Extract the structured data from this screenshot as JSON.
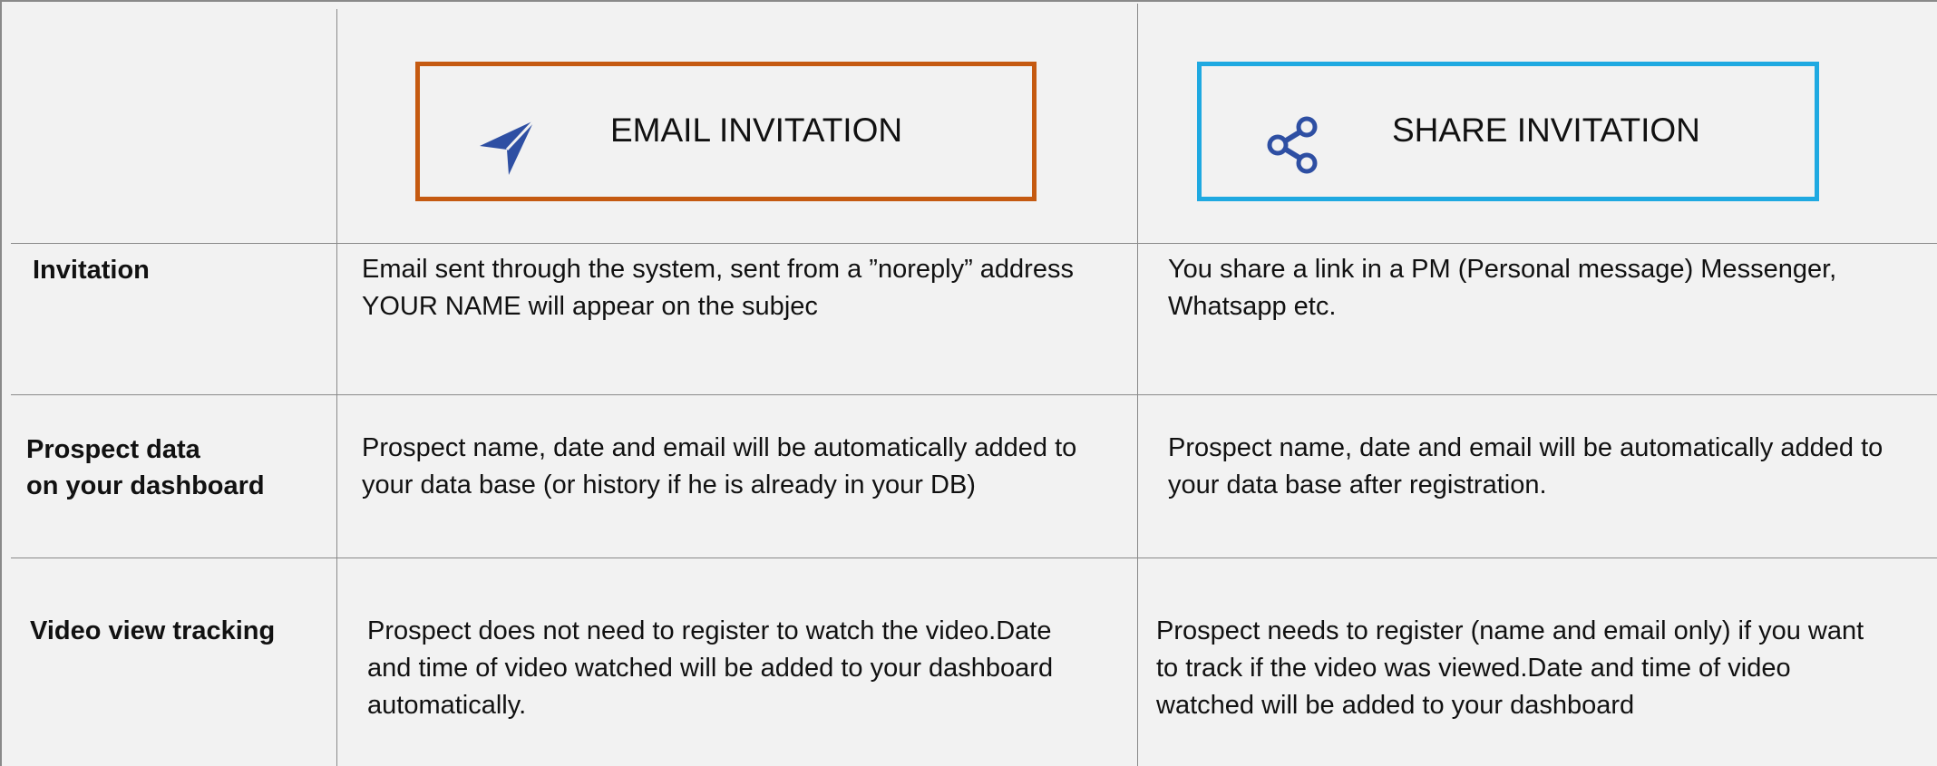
{
  "columns": {
    "email": {
      "label": "EMAIL INVITATION",
      "icon": "paper-plane-icon",
      "border_color": "#c55a11",
      "icon_color": "#2e4fa3"
    },
    "share": {
      "label": "SHARE INVITATION",
      "icon": "share-icon",
      "border_color": "#1fa9e1",
      "icon_color": "#2e4fa3"
    }
  },
  "rows": [
    {
      "label": "Invitation",
      "email": "Email sent through the system, sent from a ”noreply” address YOUR NAME will appear on the subjec",
      "share": "You share a link in a PM (Personal message) Messenger, Whatsapp etc."
    },
    {
      "label": "Prospect data on your dashboard",
      "label_lines": [
        "Prospect data",
        "on your dashboard"
      ],
      "email": "Prospect name, date and email will be automatically added to your data base (or history if he is already in your DB)",
      "share": "Prospect name, date and email will be automatically added to your data base after registration."
    },
    {
      "label": "Video view tracking",
      "email": "Prospect does not need to register to watch the video.Date and time of video watched will be added to your dashboard automatically.",
      "share": "Prospect needs to register (name and email only) if you want to track if the video was viewed.Date and time of video watched will be added to your dashboard"
    }
  ]
}
